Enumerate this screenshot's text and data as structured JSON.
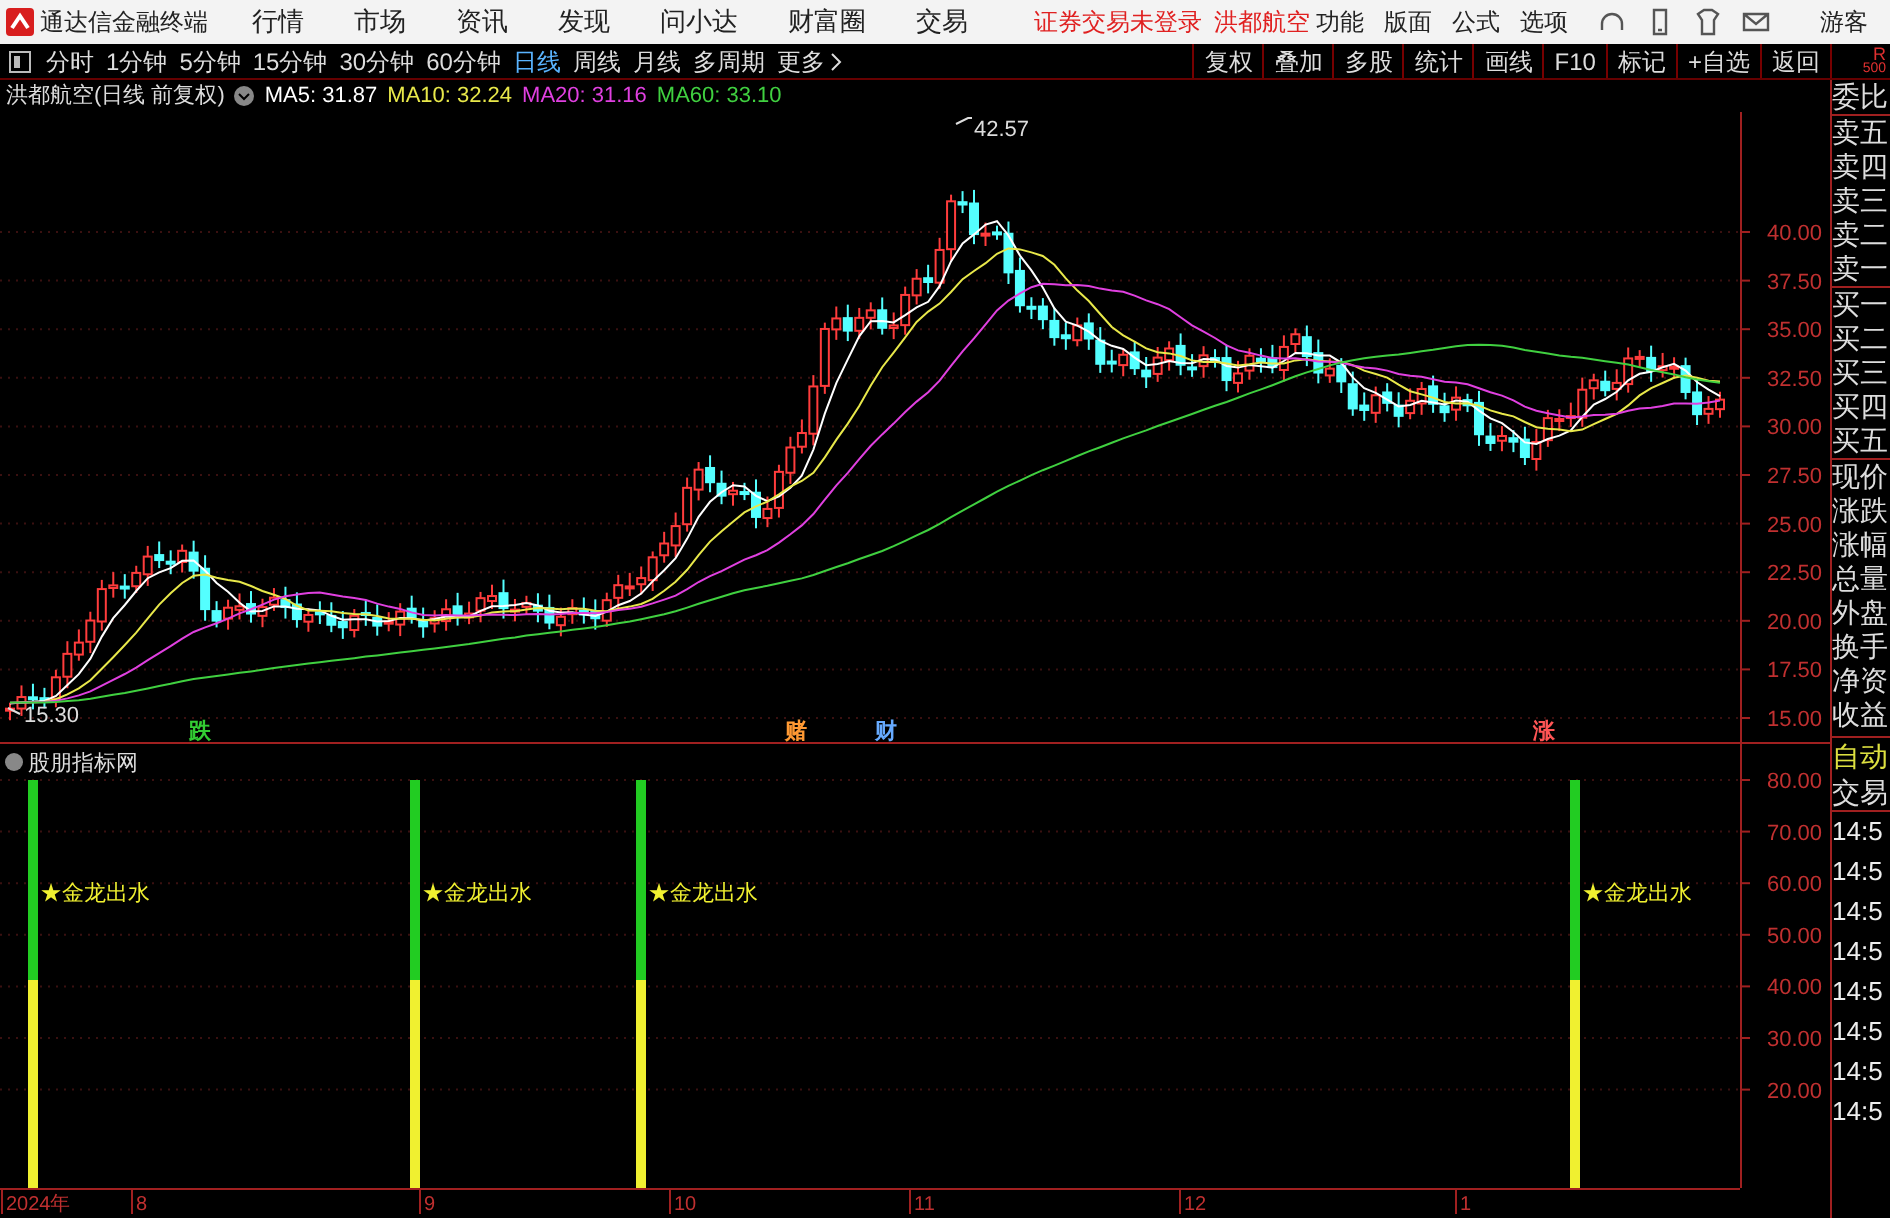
{
  "app_bar": {
    "title": "通达信金融终端",
    "menus": [
      "行情",
      "市场",
      "资讯",
      "发现",
      "问小达",
      "财富圈",
      "交易"
    ],
    "notice": "证券交易未登录",
    "stock": "洪都航空",
    "tools": [
      "功能",
      "版面",
      "公式",
      "选项"
    ],
    "user": "游客"
  },
  "period_tabs": [
    {
      "label": "分时",
      "selected": false
    },
    {
      "label": "1分钟",
      "selected": false
    },
    {
      "label": "5分钟",
      "selected": false
    },
    {
      "label": "15分钟",
      "selected": false
    },
    {
      "label": "30分钟",
      "selected": false
    },
    {
      "label": "60分钟",
      "selected": false
    },
    {
      "label": "日线",
      "selected": true
    },
    {
      "label": "周线",
      "selected": false
    },
    {
      "label": "月线",
      "selected": false
    },
    {
      "label": "多周期",
      "selected": false
    },
    {
      "label": "更多",
      "selected": false
    }
  ],
  "toolbar_buttons": [
    "复权",
    "叠加",
    "多股",
    "统计",
    "画线",
    "F10",
    "标记",
    "+自选",
    "返回"
  ],
  "level_badge": [
    "R",
    "500"
  ],
  "chart": {
    "title": "洪都航空(日线 前复权)",
    "ma": [
      {
        "label": "MA5: 31.87",
        "color": "#ffffff"
      },
      {
        "label": "MA10: 32.24",
        "color": "#e8e84a"
      },
      {
        "label": "MA20: 31.16",
        "color": "#e040e0"
      },
      {
        "label": "MA60: 33.10",
        "color": "#40d040"
      }
    ],
    "price_ticks": [
      "40.00",
      "37.50",
      "35.00",
      "32.50",
      "30.00",
      "27.50",
      "25.00",
      "22.50",
      "20.00",
      "17.50",
      "15.00"
    ],
    "high_label": "42.57",
    "low_label": "15.30",
    "markers": [
      {
        "label": "跌",
        "color": "#33cc33"
      },
      {
        "label": "赌",
        "color": "#ff9933"
      },
      {
        "label": "财",
        "color": "#66aaff"
      },
      {
        "label": "涨",
        "color": "#ff5555"
      }
    ]
  },
  "indicator": {
    "title": "股朋指标网",
    "ticks": [
      "80.00",
      "70.00",
      "60.00",
      "50.00",
      "40.00",
      "30.00",
      "20.00"
    ],
    "signals": [
      {
        "label": "★金龙出水"
      },
      {
        "label": "★金龙出水"
      },
      {
        "label": "★金龙出水"
      },
      {
        "label": "★金龙出水"
      }
    ]
  },
  "date_axis": [
    "2024年",
    "8",
    "9",
    "10",
    "11",
    "12",
    "1"
  ],
  "quote_panel": {
    "labels": [
      "委比",
      "卖五",
      "卖四",
      "卖三",
      "卖二",
      "卖一",
      "买一",
      "买二",
      "买三",
      "买四",
      "买五",
      "现价",
      "涨跌",
      "涨幅",
      "总量",
      "外盘",
      "换手",
      "净资",
      "收益"
    ],
    "auto_trade": [
      "自动",
      "交易"
    ],
    "times": [
      "14:5",
      "14:5",
      "14:5",
      "14:5",
      "14:5",
      "14:5",
      "14:5",
      "14:5"
    ]
  }
}
